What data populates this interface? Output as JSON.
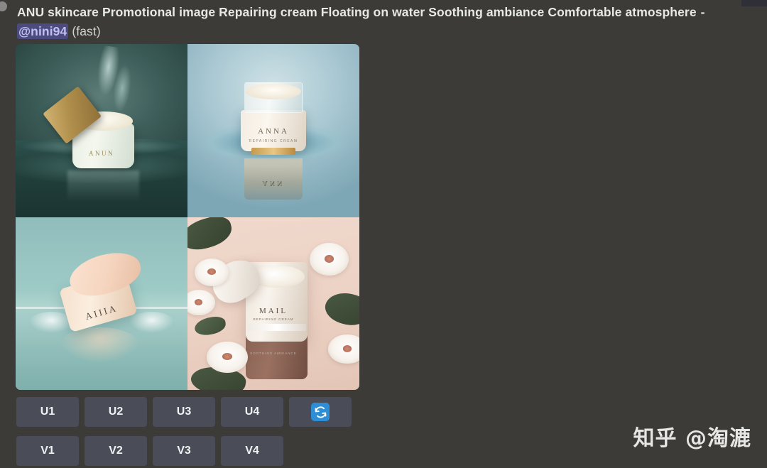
{
  "message": {
    "prompt": "ANU skincare Promotional image Repairing cream Floating on water Soothing ambiance Comfortable atmosphere",
    "dash": "-",
    "mention": "@nini94",
    "speed": "(fast)"
  },
  "image_grid": {
    "quadrants": [
      {
        "position": "top-left",
        "brand_text": "ANUN",
        "description": "Cream jar with gold lid floating on dark teal water with splash"
      },
      {
        "position": "top-right",
        "brand_text": "ANNA",
        "subline": "REPAIRING CREAM",
        "reflection_text": "ANN",
        "description": "Cream jar on pale blue background with water splash ring and golden reflection"
      },
      {
        "position": "bottom-left",
        "brand_text": "AIIIA",
        "description": "Tilted peach cream jar resting on calm teal water"
      },
      {
        "position": "bottom-right",
        "brand_text": "MAIL",
        "subline": "REPAIRING CREAM",
        "base_text": "SOOTHING AMBIANCE",
        "description": "Open cream jar with white lotus flowers and leaves on pink background"
      }
    ]
  },
  "buttons": {
    "upscale_row": [
      "U1",
      "U2",
      "U3",
      "U4"
    ],
    "variation_row": [
      "V1",
      "V2",
      "V3",
      "V4"
    ],
    "reroll_icon": "refresh-icon"
  },
  "watermark": {
    "text": "知乎 @淘漉"
  },
  "colors": {
    "background": "#3c3b38",
    "button_bg": "#4a4d57",
    "button_text": "#f0f1f3",
    "mention_bg": "#4c4b80",
    "mention_text": "#c3c0f0",
    "accent_blue": "#2d8ed6",
    "header_text": "#e8e8e6"
  }
}
